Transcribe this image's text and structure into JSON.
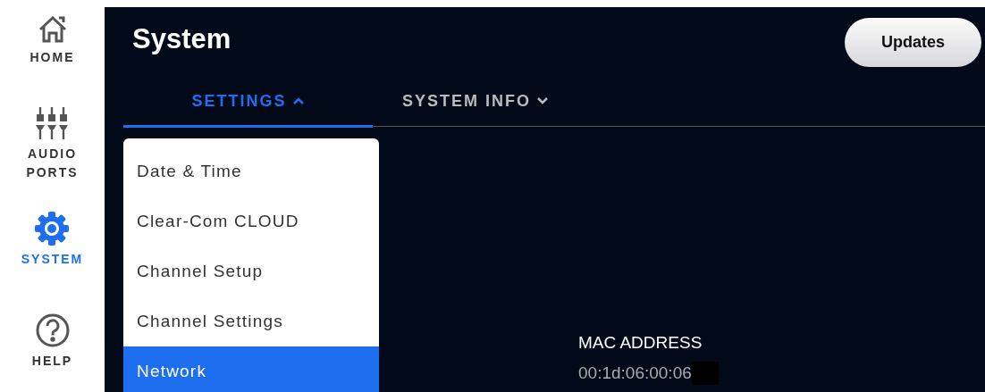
{
  "sidebar": {
    "items": [
      {
        "kind": "home",
        "label": "HOME",
        "selected": false
      },
      {
        "kind": "ports",
        "label": "AUDIO PORTS",
        "selected": false
      },
      {
        "kind": "system",
        "label": "SYSTEM",
        "selected": true
      },
      {
        "kind": "help",
        "label": "HELP",
        "selected": false
      }
    ]
  },
  "header": {
    "title": "System",
    "button": "Updates"
  },
  "tabs": [
    {
      "label": "SETTINGS",
      "selected": true,
      "expanded": true
    },
    {
      "label": "SYSTEM INFO",
      "selected": false,
      "expanded": false
    }
  ],
  "menu": {
    "items": [
      {
        "label": "Date & Time",
        "selected": false
      },
      {
        "label": "Clear-Com CLOUD",
        "selected": false
      },
      {
        "label": "Channel Setup",
        "selected": false
      },
      {
        "label": "Channel Settings",
        "selected": false
      },
      {
        "label": "Network",
        "selected": true
      }
    ]
  },
  "info": {
    "label": "MAC ADDRESS",
    "value": "00:1d:06:00:06"
  }
}
